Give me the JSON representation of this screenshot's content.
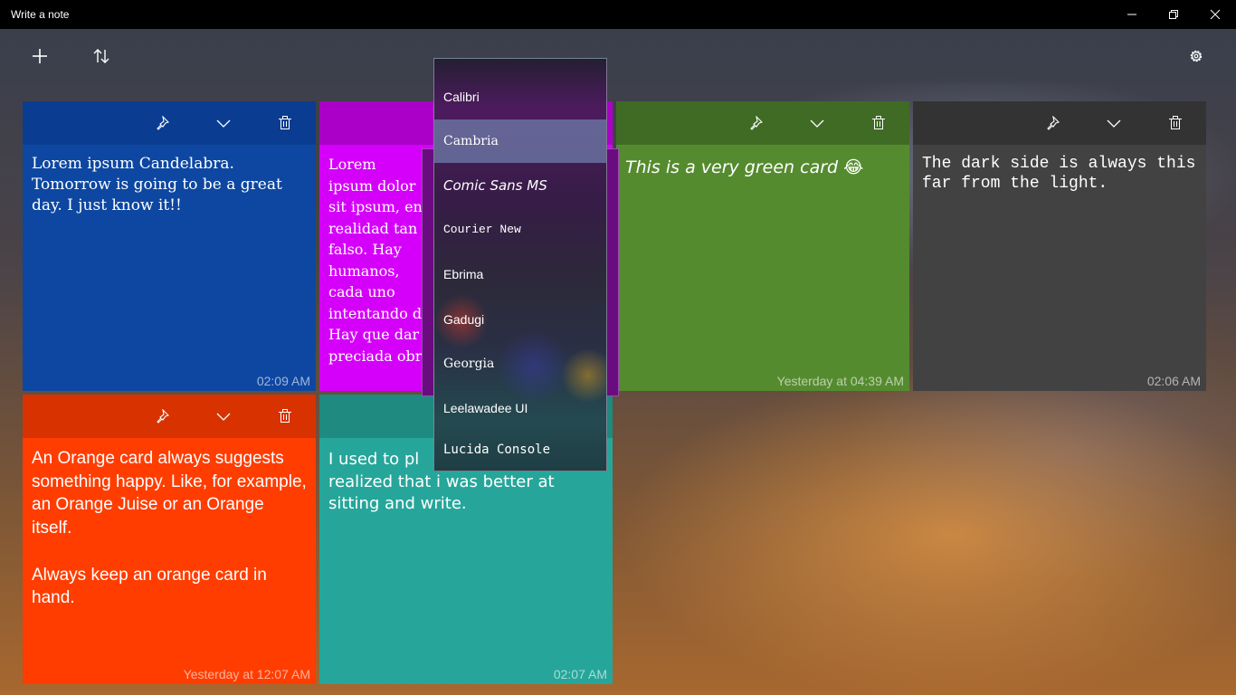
{
  "window": {
    "title": "Write a note",
    "minimize_icon": "minimize-icon",
    "restore_icon": "restore-icon",
    "close_icon": "close-icon"
  },
  "toolbar": {
    "add_icon": "plus-icon",
    "sort_icon": "sort-arrows-icon",
    "settings_icon": "gear-icon"
  },
  "cards": [
    {
      "color": "#0d47a1",
      "header_color": "#0a3d91",
      "text": "Lorem ipsum Candelabra. Tomorrow is going to be a great day. I just know it!!",
      "time": "02:09 AM"
    },
    {
      "color": "#d500f9",
      "header_color": "#aa00c7",
      "text": "Lorem ipsum dolor sit ipsum, en realidad tan falso. Hay humanos, cada uno intentando d\nHay que dar\npreciada obr",
      "time": ""
    },
    {
      "color": "#558b2f",
      "header_color": "#3f6b24",
      "text": "This is a very green card 😂",
      "time": "Yesterday at 04:39 AM"
    },
    {
      "color": "#424242",
      "header_color": "#333333",
      "text": "The dark side is always this far from the light.",
      "time": "02:06 AM"
    },
    {
      "color": "#ff3d00",
      "header_color": "#d83200",
      "text": "An Orange card always suggests something happy. Like, for example, an Orange Juise or an Orange itself.\n\nAlways keep an orange card in hand.",
      "time": "Yesterday at 12:07 AM"
    },
    {
      "color": "#26a69a",
      "header_color": "#1f8a80",
      "text": "I used to pl\nrealized that i was better at sitting and write.",
      "time": "02:07 AM"
    }
  ],
  "card_icons": {
    "pin_icon": "pin-icon",
    "expand_icon": "chevron-down-icon",
    "delete_icon": "trash-icon"
  },
  "font_dropdown": {
    "selected": "Cambria",
    "options": [
      "Calibri",
      "Cambria",
      "Comic Sans MS",
      "Courier New",
      "Ebrima",
      "Gadugi",
      "Georgia",
      "Leelawadee UI",
      "Lucida Console"
    ]
  }
}
